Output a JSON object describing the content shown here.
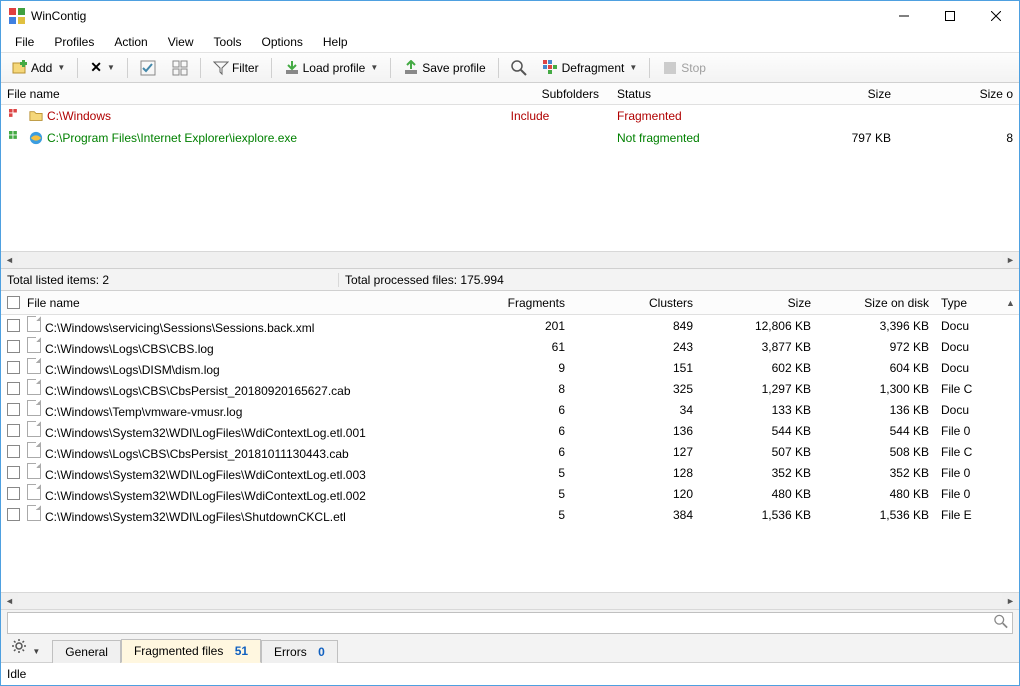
{
  "title": "WinContig",
  "menu": [
    "File",
    "Profiles",
    "Action",
    "View",
    "Tools",
    "Options",
    "Help"
  ],
  "toolbar": {
    "add": "Add",
    "filter": "Filter",
    "load_profile": "Load profile",
    "save_profile": "Save profile",
    "defragment": "Defragment",
    "stop": "Stop"
  },
  "topcols": {
    "filename": "File name",
    "subfolders": "Subfolders",
    "status": "Status",
    "size": "Size",
    "size_o": "Size o"
  },
  "toprows": [
    {
      "path": "C:\\Windows",
      "sub": "Include",
      "status": "Fragmented",
      "size": "",
      "size_o": "",
      "kind": "red",
      "icon": "folder"
    },
    {
      "path": "C:\\Program Files\\Internet Explorer\\iexplore.exe",
      "sub": "",
      "status": "Not fragmented",
      "size": "797 KB",
      "size_o": "8",
      "kind": "green",
      "icon": "ie"
    }
  ],
  "statusstrip": {
    "total_listed": "Total listed items: 2",
    "total_processed": "Total processed files: 175.994"
  },
  "botcols": {
    "filename": "File name",
    "fragments": "Fragments",
    "clusters": "Clusters",
    "size": "Size",
    "sizeondisk": "Size on disk",
    "type": "Type"
  },
  "botrows": [
    {
      "fn": "C:\\Windows\\servicing\\Sessions\\Sessions.back.xml",
      "frag": "201",
      "clu": "849",
      "size": "12,806 KB",
      "sod": "3,396 KB",
      "type": "Docu"
    },
    {
      "fn": "C:\\Windows\\Logs\\CBS\\CBS.log",
      "frag": "61",
      "clu": "243",
      "size": "3,877 KB",
      "sod": "972 KB",
      "type": "Docu"
    },
    {
      "fn": "C:\\Windows\\Logs\\DISM\\dism.log",
      "frag": "9",
      "clu": "151",
      "size": "602 KB",
      "sod": "604 KB",
      "type": "Docu"
    },
    {
      "fn": "C:\\Windows\\Logs\\CBS\\CbsPersist_20180920165627.cab",
      "frag": "8",
      "clu": "325",
      "size": "1,297 KB",
      "sod": "1,300 KB",
      "type": "File C"
    },
    {
      "fn": "C:\\Windows\\Temp\\vmware-vmusr.log",
      "frag": "6",
      "clu": "34",
      "size": "133 KB",
      "sod": "136 KB",
      "type": "Docu"
    },
    {
      "fn": "C:\\Windows\\System32\\WDI\\LogFiles\\WdiContextLog.etl.001",
      "frag": "6",
      "clu": "136",
      "size": "544 KB",
      "sod": "544 KB",
      "type": "File 0"
    },
    {
      "fn": "C:\\Windows\\Logs\\CBS\\CbsPersist_20181011130443.cab",
      "frag": "6",
      "clu": "127",
      "size": "507 KB",
      "sod": "508 KB",
      "type": "File C"
    },
    {
      "fn": "C:\\Windows\\System32\\WDI\\LogFiles\\WdiContextLog.etl.003",
      "frag": "5",
      "clu": "128",
      "size": "352 KB",
      "sod": "352 KB",
      "type": "File 0"
    },
    {
      "fn": "C:\\Windows\\System32\\WDI\\LogFiles\\WdiContextLog.etl.002",
      "frag": "5",
      "clu": "120",
      "size": "480 KB",
      "sod": "480 KB",
      "type": "File 0"
    },
    {
      "fn": "C:\\Windows\\System32\\WDI\\LogFiles\\ShutdownCKCL.etl",
      "frag": "5",
      "clu": "384",
      "size": "1,536 KB",
      "sod": "1,536 KB",
      "type": "File E"
    }
  ],
  "tabs": {
    "general": "General",
    "fragmented": "Fragmented files",
    "fragmented_count": "51",
    "errors": "Errors",
    "errors_count": "0"
  },
  "footer": "Idle"
}
